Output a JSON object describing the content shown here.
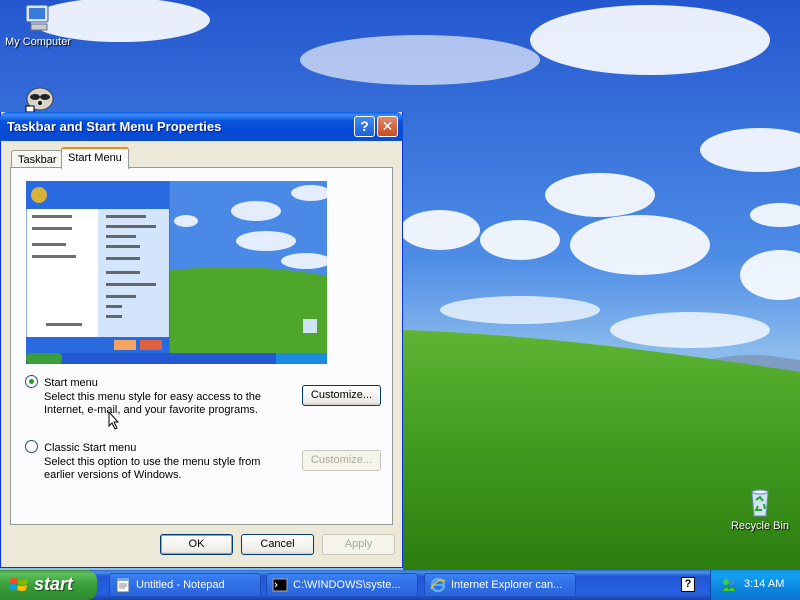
{
  "desktop": {
    "icons": [
      {
        "label": "My Computer"
      },
      {
        "label": ""
      },
      {
        "label": "Recycle Bin"
      }
    ]
  },
  "dialog": {
    "title": "Taskbar and Start Menu Properties",
    "help_glyph": "?",
    "close_glyph": "✕",
    "tabs": [
      {
        "label": "Taskbar"
      },
      {
        "label": "Start Menu"
      }
    ],
    "active_tab": "Start Menu",
    "options": [
      {
        "label": "Start menu",
        "description": "Select this menu style for easy access to the Internet, e-mail, and your favorite programs.",
        "selected": true,
        "customize_label": "Customize...",
        "customize_enabled": true
      },
      {
        "label": "Classic Start menu",
        "description": "Select this option to use the menu style from earlier versions of Windows.",
        "selected": false,
        "customize_label": "Customize...",
        "customize_enabled": false
      }
    ],
    "buttons": {
      "ok": "OK",
      "cancel": "Cancel",
      "apply": "Apply"
    }
  },
  "taskbar": {
    "start_label": "start",
    "tasks": [
      {
        "label": "Untitled - Notepad",
        "icon": "notepad-icon"
      },
      {
        "label": "C:\\WINDOWS\\syste...",
        "icon": "cmd-icon"
      },
      {
        "label": "Internet Explorer can...",
        "icon": "ie-icon"
      }
    ],
    "clock": "3:14 AM"
  },
  "colors": {
    "title_blue": "#0854e0",
    "taskbar_blue": "#245edb",
    "start_green": "#3a9e3a",
    "tray_blue": "#0f8fe9",
    "dialog_face": "#ece9d8"
  }
}
